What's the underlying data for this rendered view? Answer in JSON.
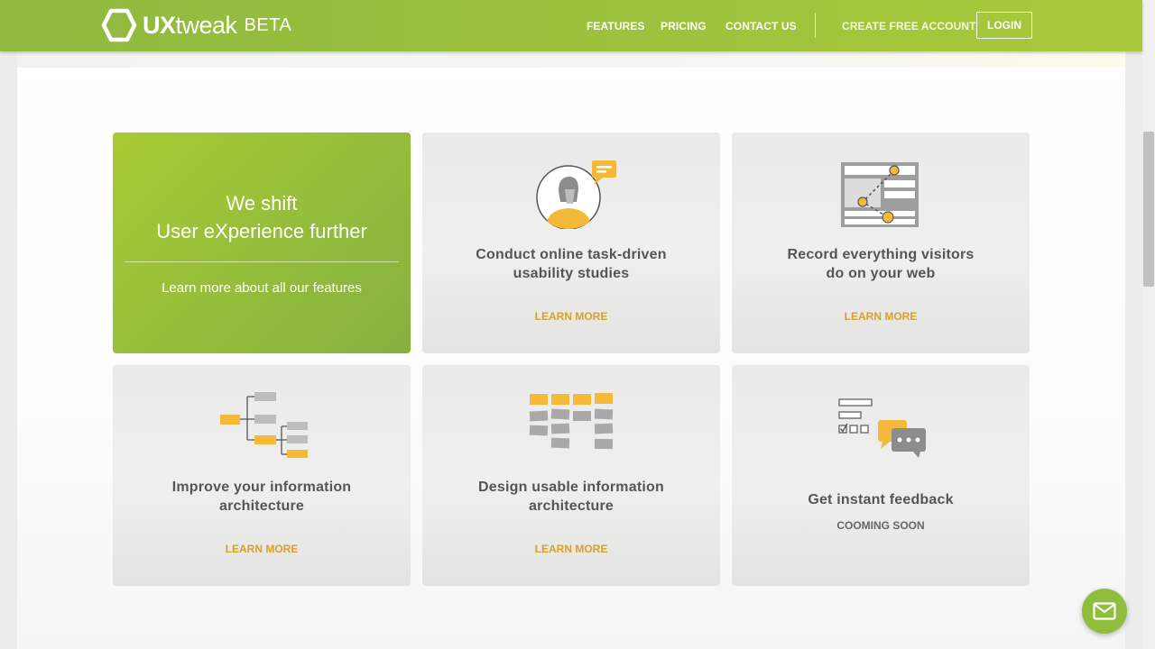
{
  "header": {
    "logo_strong": "UX",
    "logo_rest": "tweak",
    "logo_beta": "BETA",
    "nav": {
      "features": "FEATURES",
      "pricing": "PRICING",
      "contact": "CONTACT US",
      "create_account": "CREATE FREE ACCOUNT",
      "login": "LOGIN"
    }
  },
  "hero": {
    "title_line1": "We shift",
    "title_line2": "User eXperience further",
    "link": "Learn more about all our features"
  },
  "cards": [
    {
      "title_line1": "Conduct online task-driven",
      "title_line2": "usability studies",
      "link": "LEARN MORE",
      "icon": "usability-study-icon"
    },
    {
      "title_line1": "Record everything visitors",
      "title_line2": "do on your web",
      "link": "LEARN MORE",
      "icon": "session-recording-icon"
    },
    {
      "title_line1": "Improve your information",
      "title_line2": "architecture",
      "link": "LEARN MORE",
      "icon": "tree-testing-icon"
    },
    {
      "title_line1": "Design usable information",
      "title_line2": "architecture",
      "link": "LEARN MORE",
      "icon": "card-sorting-icon"
    },
    {
      "title_line1": "Get instant feedback",
      "status": "COOMING SOON",
      "icon": "feedback-icon"
    }
  ],
  "colors": {
    "brand_green": "#9cc13d",
    "accent_yellow": "#f5b93a",
    "link_orange": "#d9a02b",
    "icon_gray": "#bdbdbd"
  },
  "chat_button": {
    "icon": "mail-icon"
  }
}
